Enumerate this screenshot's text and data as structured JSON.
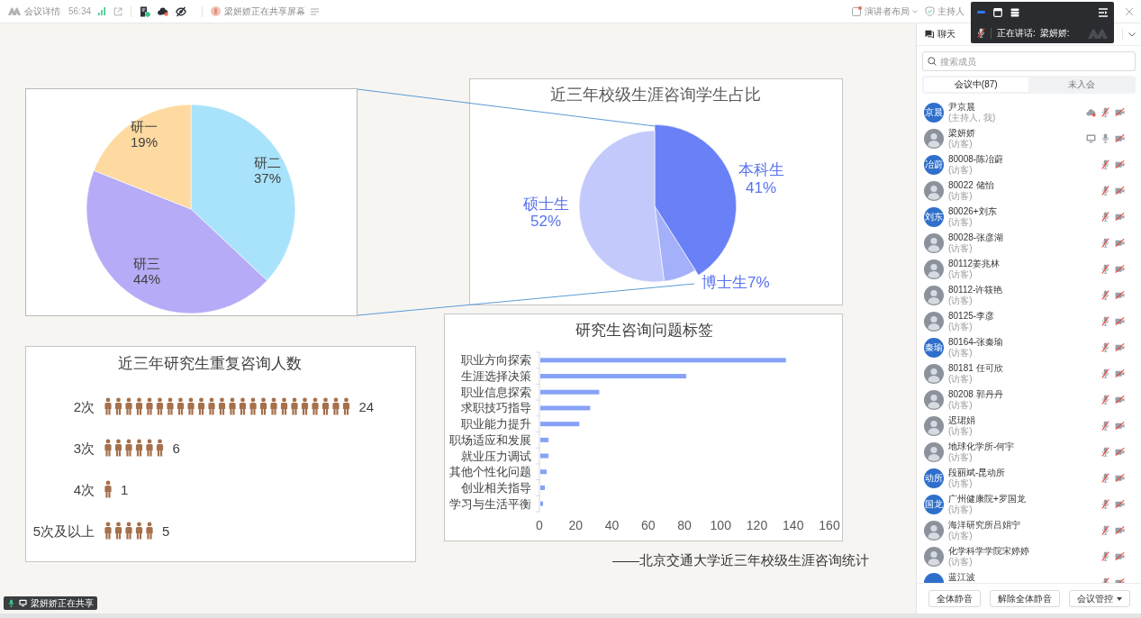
{
  "top_bar": {
    "details_link": "会议详情",
    "duration": "56:34",
    "share_notice": "梁妍娇正在共享屏幕",
    "layout_button": "演讲者布局",
    "host_button": "主持人"
  },
  "speaker_toolbar": {
    "label": "正在讲话:",
    "speaker": "梁妍娇:"
  },
  "slide": {
    "grade_pie": {
      "chart_data": {
        "type": "pie",
        "categories": [
          "研二",
          "研三",
          "研一"
        ],
        "values": [
          37,
          44,
          19
        ],
        "value_labels": [
          "37%",
          "44%",
          "19%"
        ]
      }
    },
    "student_pie": {
      "chart_data": {
        "type": "pie",
        "title": "近三年校级生涯咨询学生占比",
        "categories": [
          "本科生",
          "博士生",
          "硕士生"
        ],
        "values": [
          41,
          7,
          52
        ],
        "value_labels": [
          "41%",
          "7%",
          "52%"
        ]
      }
    },
    "repeat_pictogram": {
      "title": "近三年研究生重复咨询人数",
      "rows": [
        {
          "label": "2次",
          "count": "24"
        },
        {
          "label": "3次",
          "count": "6"
        },
        {
          "label": "4次",
          "count": "1"
        },
        {
          "label": "5次及以上",
          "count": "5"
        }
      ]
    },
    "tags_chart": {
      "chart_data": {
        "type": "bar",
        "orientation": "horizontal",
        "title": "研究生咨询问题标签",
        "categories": [
          "职业方向探索",
          "生涯选择决策",
          "职业信息探索",
          "求职技巧指导",
          "职业能力提升",
          "职场适应和发展",
          "就业压力调试",
          "其他个性化问题",
          "创业相关指导",
          "学习与生活平衡"
        ],
        "values": [
          136,
          81,
          33,
          28,
          22,
          5,
          5,
          4,
          3,
          2
        ],
        "xlim": [
          0,
          160
        ],
        "xticks": [
          0,
          20,
          40,
          60,
          80,
          100,
          120,
          140,
          160
        ]
      }
    },
    "caption": "——北京交通大学近三年校级生涯咨询统计"
  },
  "sharing_badge": "梁妍娇正在共享",
  "side_panel": {
    "chat_tab": "聊天",
    "search": {
      "placeholder": "搜索成员"
    },
    "tabs": [
      {
        "label": "会议中(87)",
        "selected": true
      },
      {
        "label": "未入会",
        "selected": false
      }
    ],
    "participants": [
      {
        "name": "尹京晨",
        "role": "(主持人, 我)",
        "avatar": {
          "kind": "initials",
          "text": "京晨"
        },
        "recording": true,
        "sharing_screen": false,
        "muted": true,
        "camera_on": false
      },
      {
        "name": "梁妍娇",
        "role": "(访客)",
        "avatar": {
          "kind": "photo"
        },
        "recording": false,
        "sharing_screen": true,
        "muted": false,
        "camera_on": false
      },
      {
        "name": "80008-陈冶蔚",
        "role": "(访客)",
        "avatar": {
          "kind": "initials",
          "text": "冶蔚"
        },
        "recording": false,
        "sharing_screen": false,
        "muted": true,
        "camera_on": false
      },
      {
        "name": "80022 储怡",
        "role": "(访客)",
        "avatar": {
          "kind": "photo"
        },
        "recording": false,
        "sharing_screen": false,
        "muted": true,
        "camera_on": false
      },
      {
        "name": "80026+刘东",
        "role": "(访客)",
        "avatar": {
          "kind": "initials",
          "text": "刘东"
        },
        "recording": false,
        "sharing_screen": false,
        "muted": true,
        "camera_on": false
      },
      {
        "name": "80028-张彦湖",
        "role": "(访客)",
        "avatar": {
          "kind": "photo"
        },
        "recording": false,
        "sharing_screen": false,
        "muted": true,
        "camera_on": false
      },
      {
        "name": "80112姜兆林",
        "role": "(访客)",
        "avatar": {
          "kind": "photo"
        },
        "recording": false,
        "sharing_screen": false,
        "muted": true,
        "camera_on": false
      },
      {
        "name": "80112-许筱艳",
        "role": "(访客)",
        "avatar": {
          "kind": "photo"
        },
        "recording": false,
        "sharing_screen": false,
        "muted": true,
        "camera_on": false
      },
      {
        "name": "80125-李彦",
        "role": "(访客)",
        "avatar": {
          "kind": "photo"
        },
        "recording": false,
        "sharing_screen": false,
        "muted": true,
        "camera_on": false
      },
      {
        "name": "80164-张秦瑜",
        "role": "(访客)",
        "avatar": {
          "kind": "initials",
          "text": "秦瑜"
        },
        "recording": false,
        "sharing_screen": false,
        "muted": true,
        "camera_on": false
      },
      {
        "name": "80181 任可欣",
        "role": "(访客)",
        "avatar": {
          "kind": "photo"
        },
        "recording": false,
        "sharing_screen": false,
        "muted": true,
        "camera_on": false
      },
      {
        "name": "80208 郭丹丹",
        "role": "(访客)",
        "avatar": {
          "kind": "photo"
        },
        "recording": false,
        "sharing_screen": false,
        "muted": true,
        "camera_on": false
      },
      {
        "name": "迟珺娟",
        "role": "(访客)",
        "avatar": {
          "kind": "photo"
        },
        "recording": false,
        "sharing_screen": false,
        "muted": true,
        "camera_on": false
      },
      {
        "name": "地球化学所-何宇",
        "role": "(访客)",
        "avatar": {
          "kind": "photo"
        },
        "recording": false,
        "sharing_screen": false,
        "muted": true,
        "camera_on": false
      },
      {
        "name": "段丽斌-昆动所",
        "role": "(访客)",
        "avatar": {
          "kind": "initials",
          "text": "动所"
        },
        "recording": false,
        "sharing_screen": false,
        "muted": true,
        "camera_on": false
      },
      {
        "name": "广州健康院+罗国龙",
        "role": "(访客)",
        "avatar": {
          "kind": "initials",
          "text": "国龙"
        },
        "recording": false,
        "sharing_screen": false,
        "muted": true,
        "camera_on": false
      },
      {
        "name": "海洋研究所吕娟宁",
        "role": "(访客)",
        "avatar": {
          "kind": "photo"
        },
        "recording": false,
        "sharing_screen": false,
        "muted": true,
        "camera_on": false
      },
      {
        "name": "化学科学学院宋婷婷",
        "role": "(访客)",
        "avatar": {
          "kind": "photo"
        },
        "recording": false,
        "sharing_screen": false,
        "muted": true,
        "camera_on": false
      },
      {
        "name": "蓝江波",
        "avatar": {
          "kind": "initials"
        },
        "recording": false,
        "sharing_screen": false,
        "muted": true,
        "camera_on": false
      }
    ],
    "buttons": [
      {
        "label": "全体静音",
        "kind": "plain"
      },
      {
        "label": "解除全体静音",
        "kind": "plain"
      },
      {
        "label": "会议管控",
        "kind": "dropdown"
      }
    ]
  }
}
